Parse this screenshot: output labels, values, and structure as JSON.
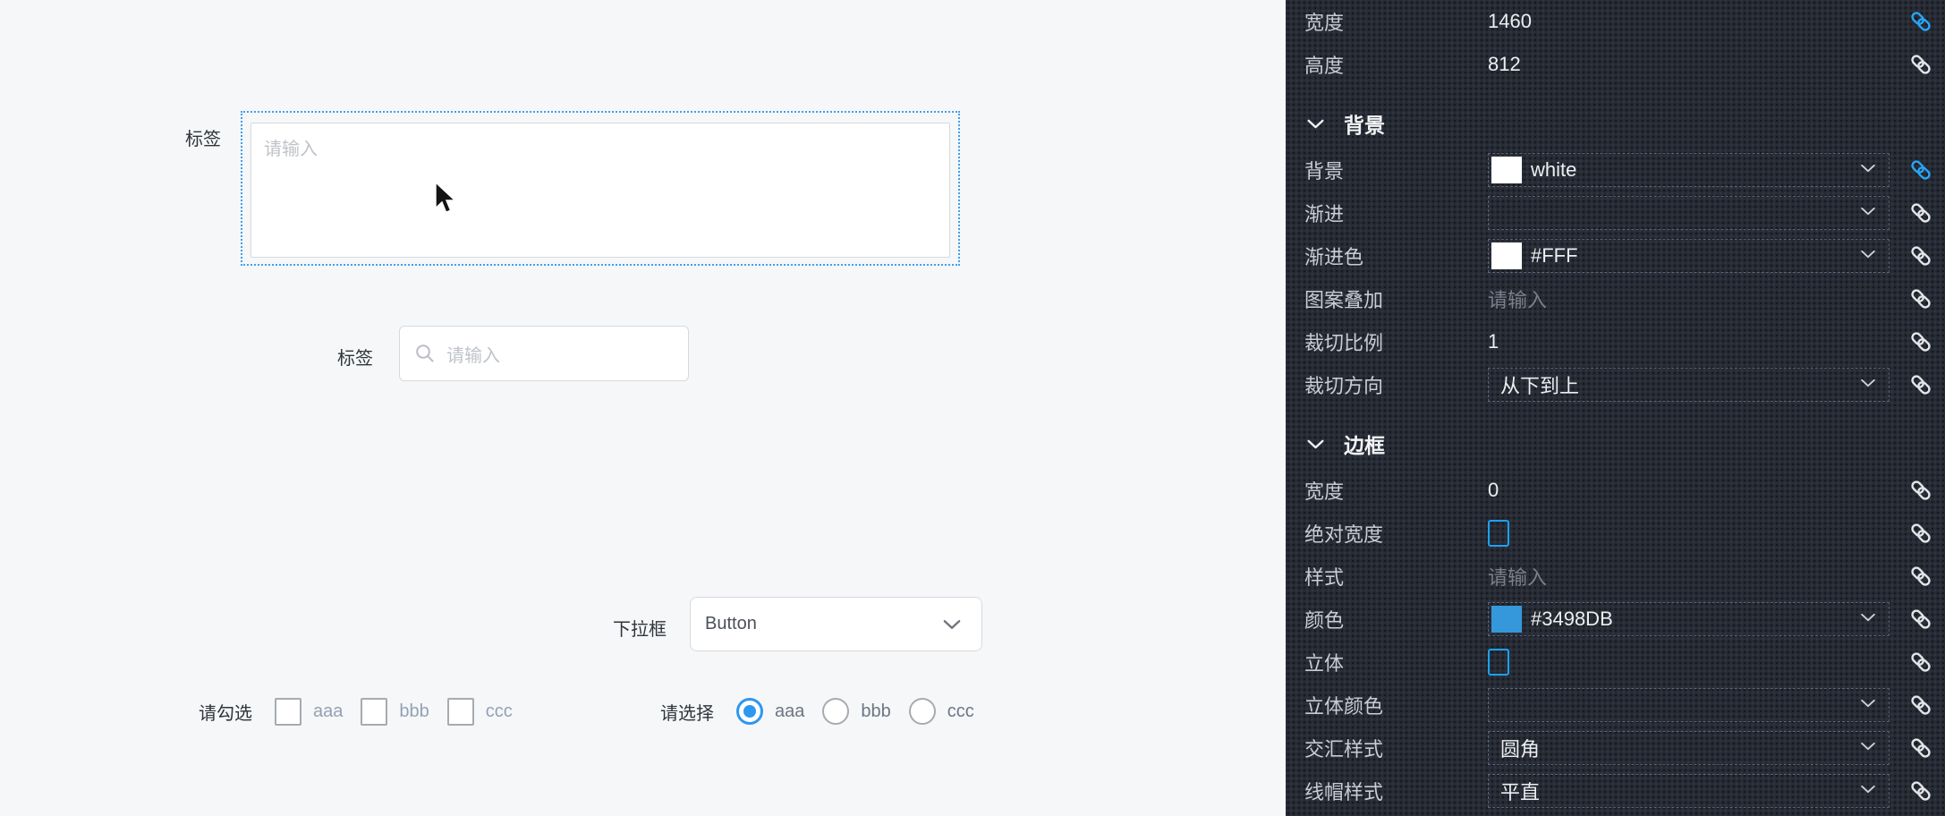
{
  "canvas": {
    "background": "#f6f7f8",
    "selection_color": "#3f9ff0",
    "textarea_widget": {
      "label": "标签",
      "placeholder": "请输入"
    },
    "search_widget": {
      "label": "标签",
      "placeholder": "请输入",
      "icon": "search-icon"
    },
    "dropdown_widget": {
      "label": "下拉框",
      "value": "Button",
      "icon": "chevron-down-icon"
    },
    "checkbox_group": {
      "label": "请勾选",
      "options": [
        {
          "label": "aaa",
          "checked": false
        },
        {
          "label": "bbb",
          "checked": false
        },
        {
          "label": "ccc",
          "checked": false
        }
      ]
    },
    "radio_group": {
      "label": "请选择",
      "options": [
        {
          "label": "aaa",
          "selected": true
        },
        {
          "label": "bbb",
          "selected": false
        },
        {
          "label": "ccc",
          "selected": false
        }
      ]
    }
  },
  "panel": {
    "background": "#272b34",
    "accent": "#1ba2f6",
    "link_active_color": "#28a5f5",
    "link_icon": "link-icon",
    "rows": [
      {
        "type": "text",
        "label": "宽度",
        "value": "1460",
        "link": "active"
      },
      {
        "type": "text",
        "label": "高度",
        "value": "812",
        "link": "normal"
      },
      {
        "type": "section",
        "label": "背景"
      },
      {
        "type": "select",
        "label": "背景",
        "value": "white",
        "swatch": "#FFFFFF",
        "link": "active"
      },
      {
        "type": "select",
        "label": "渐进",
        "value": "",
        "link": "normal"
      },
      {
        "type": "select",
        "label": "渐进色",
        "value": "#FFF",
        "swatch": "#FFFFFF",
        "link": "normal"
      },
      {
        "type": "placeholder",
        "label": "图案叠加",
        "value": "请输入",
        "link": "normal"
      },
      {
        "type": "text",
        "label": "裁切比例",
        "value": "1",
        "link": "normal"
      },
      {
        "type": "select",
        "label": "裁切方向",
        "value": "从下到上",
        "link": "normal"
      },
      {
        "type": "section",
        "label": "边框"
      },
      {
        "type": "text",
        "label": "宽度",
        "value": "0",
        "link": "normal"
      },
      {
        "type": "checkbox",
        "label": "绝对宽度",
        "checked": false,
        "link": "normal"
      },
      {
        "type": "placeholder",
        "label": "样式",
        "value": "请输入",
        "link": "normal"
      },
      {
        "type": "select",
        "label": "颜色",
        "value": "#3498DB",
        "swatch": "#3498DB",
        "link": "normal"
      },
      {
        "type": "checkbox",
        "label": "立体",
        "checked": false,
        "link": "normal"
      },
      {
        "type": "select",
        "label": "立体颜色",
        "value": "",
        "link": "normal"
      },
      {
        "type": "select",
        "label": "交汇样式",
        "value": "圆角",
        "link": "normal"
      },
      {
        "type": "select",
        "label": "线帽样式",
        "value": "平直",
        "link": "normal"
      }
    ]
  }
}
